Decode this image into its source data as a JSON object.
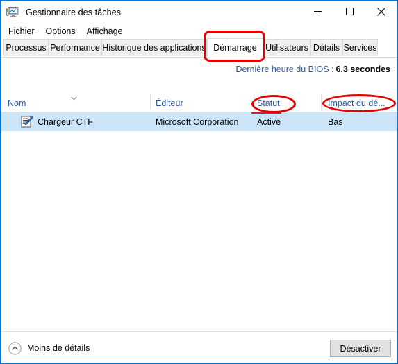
{
  "window": {
    "title": "Gestionnaire des tâches",
    "icon": "task-manager-monitor-icon",
    "controls": {
      "minimize": "minimize-icon",
      "maximize": "maximize-icon",
      "close": "close-icon"
    },
    "border_color": "#0078d7"
  },
  "menu": {
    "items": [
      {
        "label": "Fichier"
      },
      {
        "label": "Options"
      },
      {
        "label": "Affichage"
      }
    ]
  },
  "tabs": {
    "active_index": 3,
    "items": [
      {
        "label": "Processus"
      },
      {
        "label": "Performance"
      },
      {
        "label": "Historique des applications"
      },
      {
        "label": "Démarrage"
      },
      {
        "label": "Utilisateurs"
      },
      {
        "label": "Détails"
      },
      {
        "label": "Services"
      }
    ]
  },
  "bios": {
    "label": "Dernière heure du BIOS :",
    "value": "6.3 secondes"
  },
  "table": {
    "columns": [
      {
        "label": "Nom",
        "sort_icon": "chevron-down-icon"
      },
      {
        "label": "Éditeur"
      },
      {
        "label": "Statut"
      },
      {
        "label": "Impact du dé..."
      }
    ],
    "rows": [
      {
        "icon": "ctf-loader-notepad-pencil-icon",
        "name": "Chargeur CTF",
        "publisher": "Microsoft Corporation",
        "status": "Activé",
        "impact": "Bas",
        "selected": true
      }
    ],
    "selection_color": "#cce4f7",
    "header_color": "#2a5699"
  },
  "footer": {
    "less_details_label": "Moins de détails",
    "less_details_icon": "chevron-up-circle-icon",
    "disable_button": "Désactiver"
  },
  "annotations": {
    "color": "#e60000",
    "items": [
      {
        "target": "tab-demarrage",
        "shape": "rounded-rect"
      },
      {
        "target": "column-statut",
        "shape": "oval"
      },
      {
        "target": "column-impact",
        "shape": "oval"
      }
    ]
  }
}
